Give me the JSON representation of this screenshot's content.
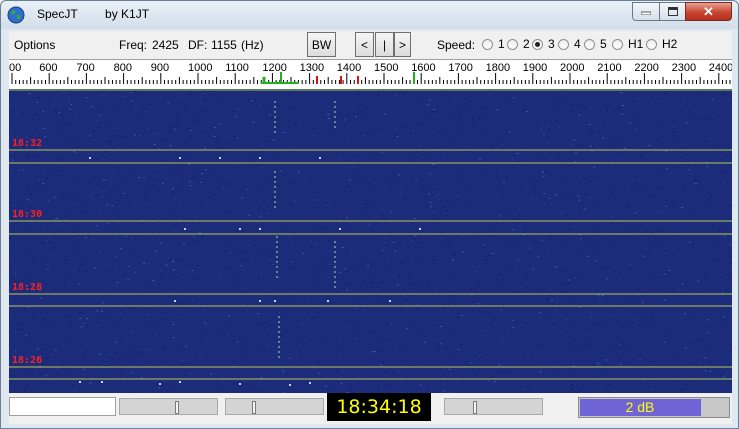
{
  "window": {
    "title": "SpecJT",
    "author": "by K1JT",
    "close_glyph": "✕"
  },
  "menubar": {
    "options_label": "Options",
    "freq_label": "Freq:",
    "freq_value": "2425",
    "df_label": "DF:",
    "df_value": "1155",
    "df_unit": "(Hz)",
    "bw_label": "BW",
    "prev_label": "<",
    "bar_label": "|",
    "next_label": ">",
    "speed_label": "Speed:",
    "speed_options": [
      "1",
      "2",
      "3",
      "4",
      "5",
      "H1",
      "H2"
    ],
    "speed_selected": "3"
  },
  "scale": {
    "ticks": [
      "00",
      "600",
      "700",
      "800",
      "900",
      "1000",
      "1100",
      "1200",
      "1300",
      "1400",
      "1500",
      "1600",
      "1700",
      "1800",
      "1900",
      "2000",
      "2100",
      "2200",
      "2300",
      "2400"
    ]
  },
  "waterfall": {
    "timestamps": [
      "18:32",
      "18:30",
      "18:28",
      "18:26"
    ],
    "colors": {
      "background": "#1c2b7a",
      "separator": "#b8c850",
      "timestamp": "#ff2020"
    }
  },
  "status": {
    "clock": "18:34:18",
    "level_text": "2 dB",
    "level_fraction": 0.82
  },
  "icons": {
    "app": "globe-icon",
    "minimize": "minimize-icon",
    "maximize": "maximize-icon",
    "close": "close-icon"
  }
}
